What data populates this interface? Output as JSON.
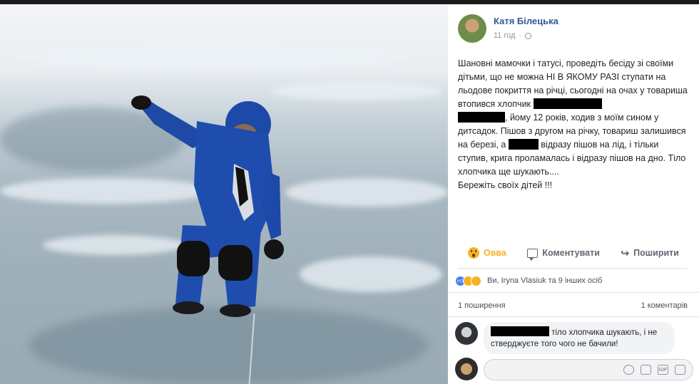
{
  "post": {
    "author": "Катя Білецька",
    "time": "11 год",
    "time_sep": "·",
    "text_parts": {
      "p1": "Шановні мамочки і татусі, проведіть бесіду зі своїми дітьми, що не можна НІ В ЯКОМУ РАЗІ ступати на льодове покриття на річці, сьогодні на очах у товариша втопився хлопчик ",
      "p2": ", йому 12 років, ходив з моїм сином у дитсадок. Пішов з другом на річку, товариш залишився на березі, а ",
      "p3": " відразу пішов на лід, і тільки ступив, крига проламалась і відразу пішов на дно. Тіло хлопчика ще шукають....\nБережіть своїх дітей !!!"
    }
  },
  "actions": {
    "wow": "Овва",
    "comment": "Коментувати",
    "share": "Поширити"
  },
  "reactions": {
    "summary": "Ви, Iryna Vlasiuk та 9 інших осіб",
    "icons": [
      "like-icon",
      "sad-icon",
      "wow-icon"
    ]
  },
  "counts": {
    "shares": "1 поширення",
    "comments": "1 коментарів"
  },
  "comment": {
    "text": " тіло хлопчика шукають, і не стверджуєте того чого не бачили!"
  },
  "composer": {
    "icons": [
      "emoji-icon",
      "camera-icon",
      "gif-icon",
      "sticker-icon"
    ],
    "gif_label": "GIF"
  },
  "colors": {
    "link": "#365899",
    "wow_accent": "#f7b125",
    "like_blue": "#4a7cf0"
  }
}
